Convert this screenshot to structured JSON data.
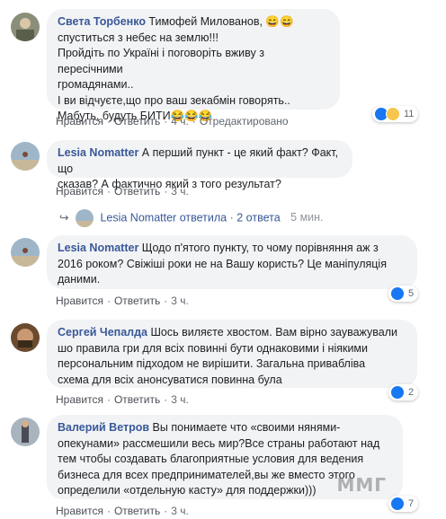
{
  "comments": [
    {
      "author": "Света Торбенко",
      "text_l1": " Тимофей Милованов, 😄😄",
      "text_l2": "спуститься з небес на землю!!!",
      "text_l3": "Пройдіть по Україні і поговоріть вживу з пересічними",
      "text_l4": "громадянами..",
      "text_l5": "І ви відчуєте,що про ваш зекабмін говорять..",
      "text_l6": "Мабуть, будуть БИТИ😂😂😂",
      "like": "Нравится",
      "reply": "Ответить",
      "time": "4 ч.",
      "edited": "Отредактировано",
      "reactions": "11"
    },
    {
      "author": "Lesia Nomatter",
      "text_l1": " А перший пункт - це який факт? Факт, що",
      "text_l2": "сказав? А фактично який з того результат?",
      "like": "Нравится",
      "reply": "Ответить",
      "time": "3 ч.",
      "replies": {
        "author": "Lesia Nomatter",
        "action": "ответила",
        "count": "2 ответа",
        "time": "5 мин."
      }
    },
    {
      "author": "Lesia Nomatter",
      "text_l1": " Щодо п'ятого пункту, то чому порівняння аж з",
      "text_l2": "2016 роком? Свіжіші роки не на Вашу користь? Це маніпуляція",
      "text_l3": "даними.",
      "like": "Нравится",
      "reply": "Ответить",
      "time": "3 ч.",
      "reactions": "5"
    },
    {
      "author": "Сергей Чепалда",
      "text_l1": " Шось виляєте хвостом. Вам вірно зауважували",
      "text_l2": "шо правила гри для всіх повинні бути однаковими і ніякими",
      "text_l3": "персональним підходом не вирішити. Загальна привабліва",
      "text_l4": "схема для всіх анонсуватися повинна була",
      "like": "Нравится",
      "reply": "Ответить",
      "time": "3 ч.",
      "reactions": "2"
    },
    {
      "author": "Валерий Ветров",
      "text_l1": " Вы понимаете что «своими нянями-",
      "text_l2": "опекунами» рассмешили весь мир?Все страны работают над",
      "text_l3": "тем чтобы создавать благоприятные условия для ведения",
      "text_l4": "бизнеса для всех предпринимателей,вы же вместо этого",
      "text_l5": "определили «отдельную касту» для поддержки)))",
      "like": "Нравится",
      "reply": "Ответить",
      "time": "3 ч.",
      "reactions": "7"
    }
  ],
  "watermark": "ММГ",
  "colors": {
    "link": "#385898",
    "bubble": "#f2f3f5",
    "like": "#1877f2"
  }
}
